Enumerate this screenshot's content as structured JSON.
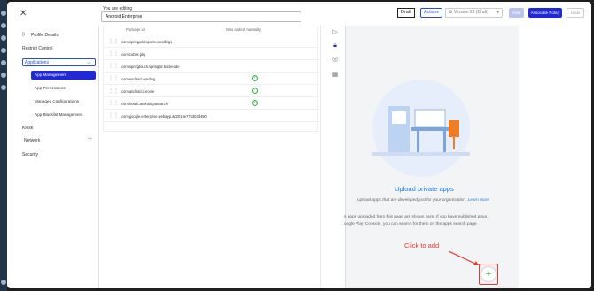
{
  "header": {
    "close_icon": "close-icon",
    "editing_label": "You are editing",
    "policy_name": "Android Enterprise",
    "draft_badge": "Draft",
    "actions_label": "Actions",
    "version_label": "Version 25 (Draft)",
    "save_label": "Save",
    "associate_label": "Associate Policy",
    "undo_label": "Undo"
  },
  "sidebar": {
    "profile_details": "Profile Details",
    "restrict_control": "Restrict Control",
    "applications": "Applications",
    "sub_items": [
      "App Management",
      "App Permissions",
      "Managed Configurations",
      "App Blacklist Management"
    ],
    "kiosk": "Kiosk",
    "network": "Network",
    "security": "Security"
  },
  "table": {
    "col_package": "Package id",
    "col_manual": "Was added manually",
    "rows": [
      {
        "pkg": "com.springuild.sports.vandlings",
        "manual": false
      },
      {
        "pkg": "com.cobsk.pkg",
        "manual": false
      },
      {
        "pkg": "com.springtouch.springlar.bockeode",
        "manual": false
      },
      {
        "pkg": "com.android.vending",
        "manual": true
      },
      {
        "pkg": "com.android.chrome",
        "manual": true
      },
      {
        "pkg": "com.howitt.android.passarch",
        "manual": true
      },
      {
        "pkg": "com.google.enterprise.webapp.a02014e775303d490",
        "manual": false
      }
    ]
  },
  "preview": {
    "upload_title": "Upload private apps",
    "upload_subtitle": "Upload apps that are developed just for your organisation.",
    "learn_more": "Learn more",
    "note_line1": "s apps uploaded from this page are shown here. If you have published priva",
    "note_line2": "oogle Play Console, you can search for them on the apps search page.",
    "click_to_add": "Click to add",
    "add_symbol": "+",
    "accent_red": "#e53935",
    "accent_blue": "#2128d6"
  }
}
